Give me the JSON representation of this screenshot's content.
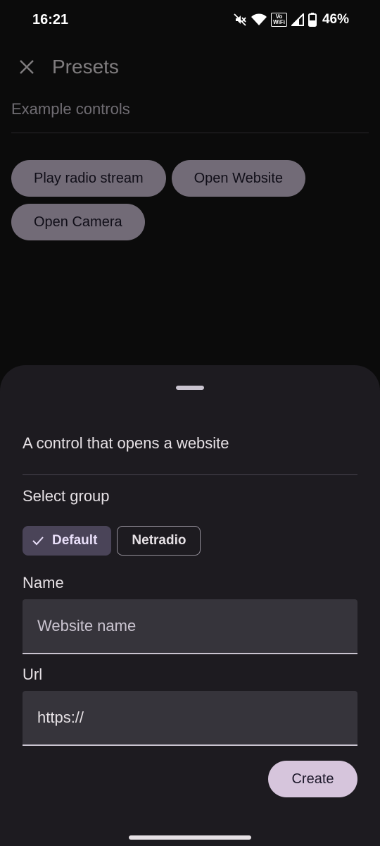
{
  "status_bar": {
    "time": "16:21",
    "wifi_tag_top": "Vo",
    "wifi_tag_bottom": "WiFi",
    "battery_percent": "46%",
    "icons": [
      "mute-icon",
      "wifi-icon",
      "vowifi-icon",
      "signal-icon",
      "battery-icon"
    ]
  },
  "app_bar": {
    "title": "Presets",
    "close_icon": "close-icon"
  },
  "presets": {
    "section_label": "Example controls",
    "chips": [
      "Play radio stream",
      "Open Website",
      "Open Camera"
    ]
  },
  "sheet": {
    "description": "A control that opens a website",
    "group_label": "Select group",
    "groups": [
      {
        "label": "Default",
        "selected": true
      },
      {
        "label": "Netradio",
        "selected": false
      }
    ],
    "name_label": "Name",
    "name_placeholder": "Website name",
    "url_label": "Url",
    "url_value": "https://",
    "create_label": "Create"
  },
  "colors": {
    "sheet_bg": "#1d1b20",
    "chip_bg": "#cfc2d8",
    "selected_filter_bg": "#4a4458",
    "field_bg": "#36343b",
    "primary_button": "#d6c5dc"
  }
}
